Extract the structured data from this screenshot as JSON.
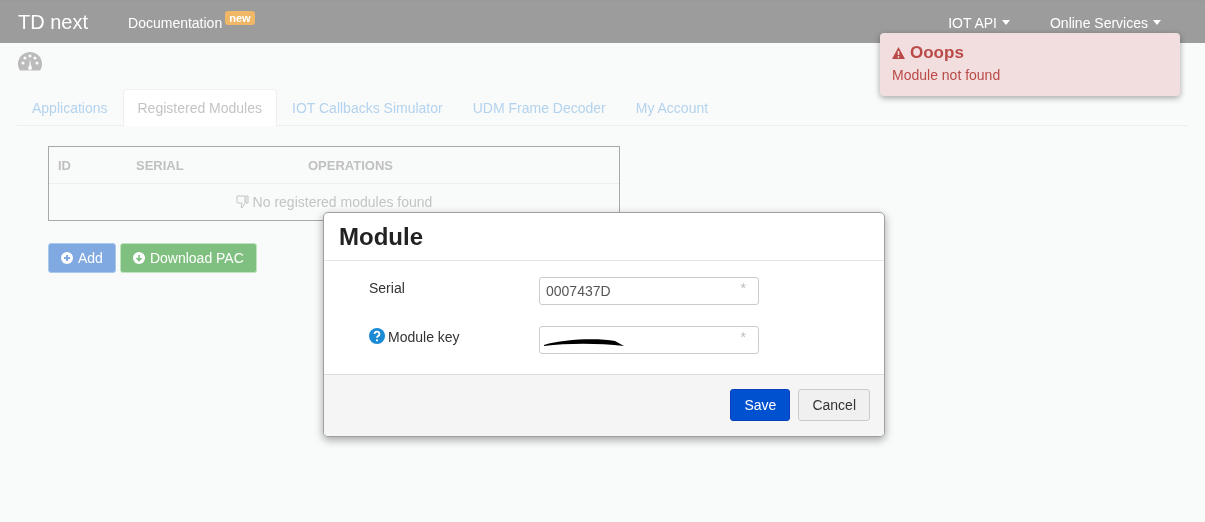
{
  "navbar": {
    "brand": "TD next",
    "links": [
      {
        "label": "Documentation",
        "badge": "new"
      }
    ],
    "dropdowns": [
      {
        "label": "IOT API"
      },
      {
        "label": "Online Services"
      }
    ]
  },
  "tabs": [
    {
      "label": "Applications",
      "selected": false
    },
    {
      "label": "Registered Modules",
      "selected": true
    },
    {
      "label": "IOT Callbacks Simulator",
      "selected": false
    },
    {
      "label": "UDM Frame Decoder",
      "selected": false
    },
    {
      "label": "My Account",
      "selected": false
    }
  ],
  "table": {
    "columns": [
      "ID",
      "SERIAL",
      "OPERATIONS"
    ],
    "empty_message": "No registered modules found"
  },
  "buttons": [
    {
      "label": "Add",
      "kind": "add"
    },
    {
      "label": "Download PAC",
      "kind": "download"
    }
  ],
  "modal": {
    "title": "Module",
    "fields": [
      {
        "label": "Serial",
        "value": "0007437D",
        "required_mark": "*",
        "help": false,
        "redacted": false
      },
      {
        "label": "Module key",
        "required_mark": "*",
        "help": true,
        "redacted": true
      }
    ],
    "buttons": [
      {
        "label": "Save",
        "kind": "primary"
      },
      {
        "label": "Cancel",
        "kind": "default"
      }
    ]
  },
  "toast": {
    "title": "Ooops",
    "message": "Module not found"
  }
}
